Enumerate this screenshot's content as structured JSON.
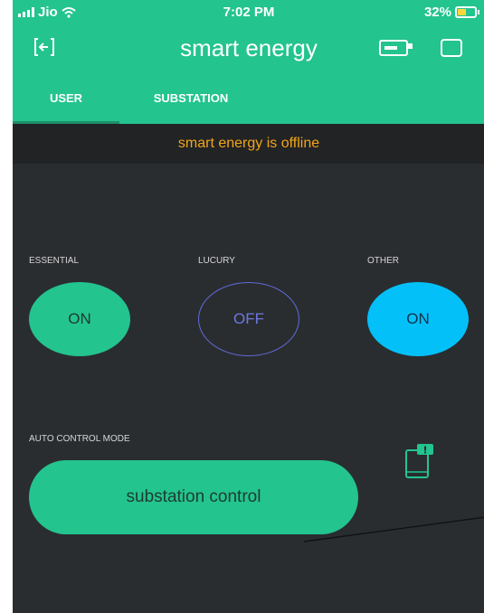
{
  "status_bar": {
    "carrier": "Jio",
    "time": "7:02 PM",
    "battery": "32%",
    "battery_level": 0.32
  },
  "header": {
    "title": "smart energy",
    "icons": [
      "back-square-icon",
      "device-status-icon",
      "square-icon"
    ]
  },
  "tabs": [
    {
      "label": "USER",
      "active": true
    },
    {
      "label": "SUBSTATION",
      "active": false
    }
  ],
  "status_message": "smart energy is offline",
  "controls": [
    {
      "label": "ESSENTIAL",
      "state": "ON",
      "color": "#23c48e"
    },
    {
      "label": "LUCURY",
      "state": "OFF",
      "color": "#5f6ad6"
    },
    {
      "label": "OTHER",
      "state": "ON",
      "color": "#04c0f8"
    }
  ],
  "auto_control": {
    "label": "AUTO CONTROL MODE",
    "button_label": "substation control"
  },
  "colors": {
    "accent": "#23c48e",
    "background": "#2a2d30",
    "offline_text": "#f2a51a",
    "blue": "#04c0f8"
  }
}
